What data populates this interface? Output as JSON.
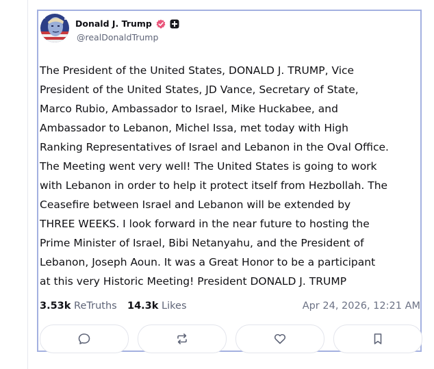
{
  "post": {
    "author": {
      "display_name": "Donald J. Trump",
      "handle": "@realDonaldTrump",
      "verified_icon": "verified-badge-icon",
      "plus_icon": "plus-badge-icon",
      "verified_color": "#e9557a"
    },
    "text": "The President of the United States, DONALD J. TRUMP, Vice\nPresident of the United States, JD Vance, Secretary of State,\nMarco Rubio, Ambassador to Israel, Mike Huckabee, and\nAmbassador to Lebanon, Michel Issa, met today with High\nRanking Representatives of Israel and Lebanon in the Oval Office.\nThe Meeting went very well! The United States is going to work\nwith Lebanon in order to help it protect itself from Hezbollah. The\nCeasefire between Israel and Lebanon will be extended by\nTHREE WEEKS. I look forward in the near future to hosting the\nPrime Minister of Israel, Bibi Netanyahu, and the President of\nLebanon, Joseph Aoun. It was a Great Honor to be a participant\nat this very Historic Meeting! President DONALD J. TRUMP",
    "stats": {
      "retruths_count": "3.53k",
      "retruths_label": "ReTruths",
      "likes_count": "14.3k",
      "likes_label": "Likes"
    },
    "timestamp": "Apr 24, 2026, 12:21 AM",
    "actions": [
      {
        "icon": "reply-icon"
      },
      {
        "icon": "retruth-icon"
      },
      {
        "icon": "like-icon"
      },
      {
        "icon": "bookmark-icon"
      }
    ]
  },
  "colors": {
    "card_border": "#a3b0e0",
    "muted_text": "#5e6477"
  }
}
